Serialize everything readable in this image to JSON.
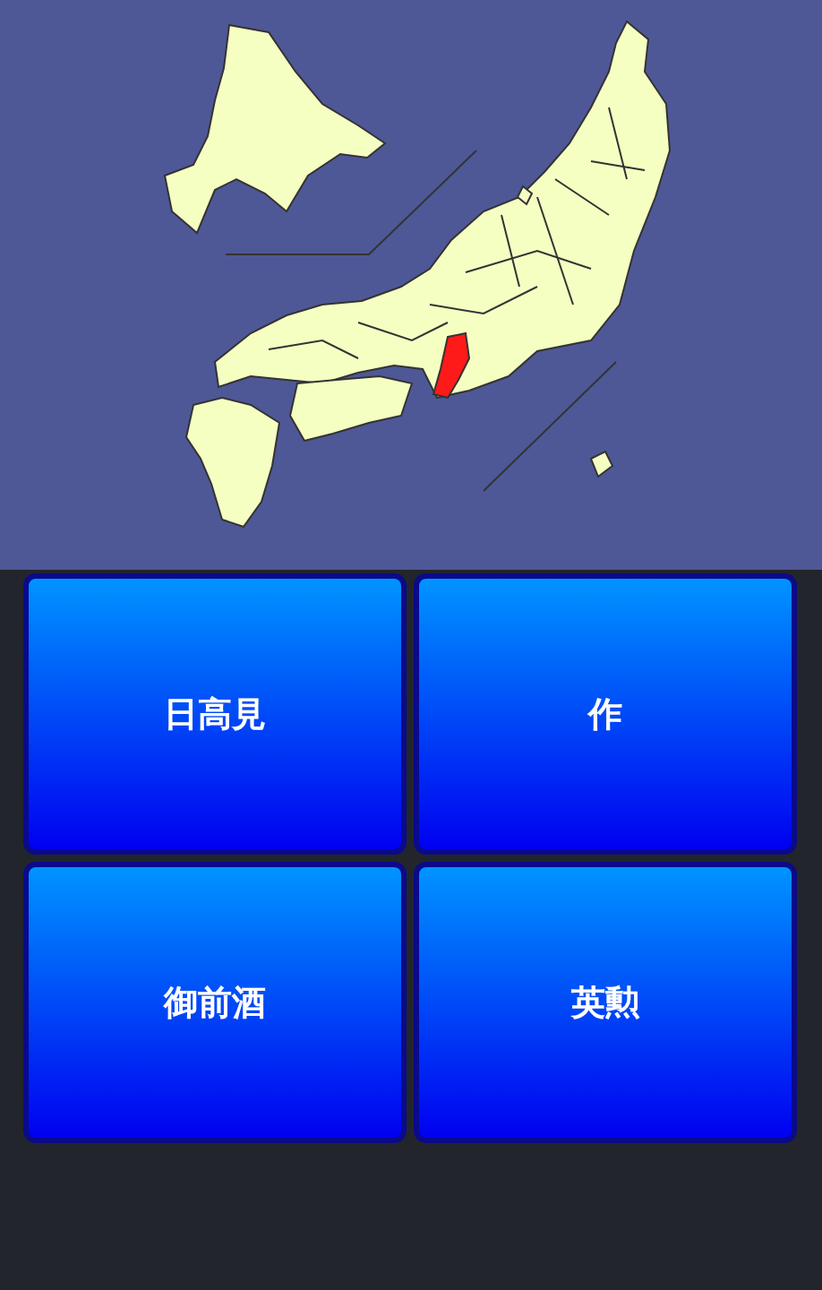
{
  "answers": [
    {
      "label": "日高見"
    },
    {
      "label": "作"
    },
    {
      "label": "御前酒"
    },
    {
      "label": "英勲"
    }
  ]
}
